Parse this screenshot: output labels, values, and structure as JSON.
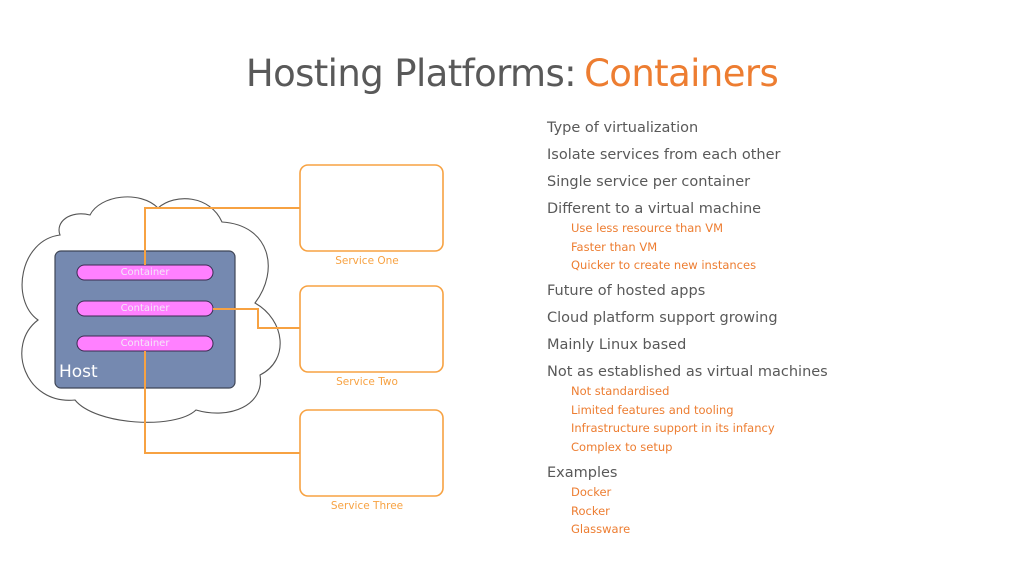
{
  "slide": {
    "title_main": "Hosting Platforms:",
    "title_accent": "Containers",
    "colors": {
      "title": "#595959",
      "accent": "#ED7D31",
      "connector": "#F7A242",
      "host_fill": "#7589B0",
      "container_fill": "#FF80FF"
    }
  },
  "diagram": {
    "cloud_label": "",
    "host_label": "Host",
    "containers": [
      {
        "label": "Container"
      },
      {
        "label": "Container"
      },
      {
        "label": "Container"
      }
    ],
    "services": [
      {
        "label": "Service One"
      },
      {
        "label": "Service Two"
      },
      {
        "label": "Service Three"
      }
    ]
  },
  "bullets": [
    {
      "text": "Type of virtualization",
      "sub": []
    },
    {
      "text": "Isolate services from each other",
      "sub": []
    },
    {
      "text": "Single service per container",
      "sub": []
    },
    {
      "text": "Different to a virtual machine",
      "sub": [
        "Use less resource than VM",
        "Faster than VM",
        "Quicker to create new instances"
      ]
    },
    {
      "text": "Future of hosted apps",
      "sub": []
    },
    {
      "text": "Cloud platform support growing",
      "sub": []
    },
    {
      "text": "Mainly Linux based",
      "sub": []
    },
    {
      "text": "Not as established as virtual machines",
      "sub": [
        "Not standardised",
        "Limited features and tooling",
        "Infrastructure support in its infancy",
        "Complex to setup"
      ]
    },
    {
      "text": "Examples",
      "sub": [
        "Docker",
        "Rocker",
        "Glassware"
      ]
    }
  ]
}
